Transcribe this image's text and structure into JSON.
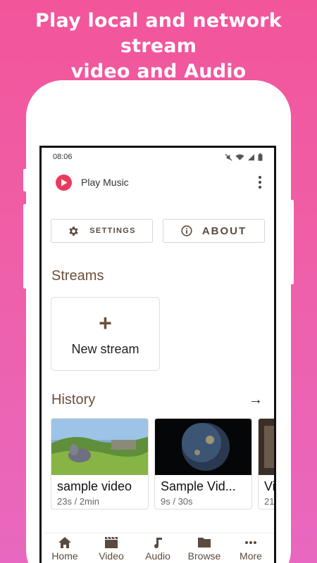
{
  "promo": {
    "line1": "Play local and network stream",
    "line2": "video and Audio"
  },
  "status": {
    "time": "08:06"
  },
  "app": {
    "title": "Play Music",
    "logo_icon": "play-circle-icon",
    "accent": "#ea3b5e"
  },
  "buttons": {
    "settings": "SETTINGS",
    "about": "ABOUT"
  },
  "streams": {
    "title": "Streams",
    "new_stream": "New stream"
  },
  "history": {
    "title": "History",
    "items": [
      {
        "title": "sample video",
        "meta": "23s / 2min"
      },
      {
        "title": "Sample Vid...",
        "meta": "9s / 30s"
      },
      {
        "title": "Vi",
        "meta": "21"
      }
    ]
  },
  "nav": {
    "items": [
      {
        "label": "Home",
        "icon": "home-icon"
      },
      {
        "label": "Video",
        "icon": "film-icon"
      },
      {
        "label": "Audio",
        "icon": "music-note-icon"
      },
      {
        "label": "Browse",
        "icon": "folder-icon"
      },
      {
        "label": "More",
        "icon": "more-dots-icon"
      }
    ]
  },
  "colors": {
    "brown_text": "#6b4f3a",
    "background_top": "#f2559a",
    "background_bottom": "#e868c0"
  }
}
